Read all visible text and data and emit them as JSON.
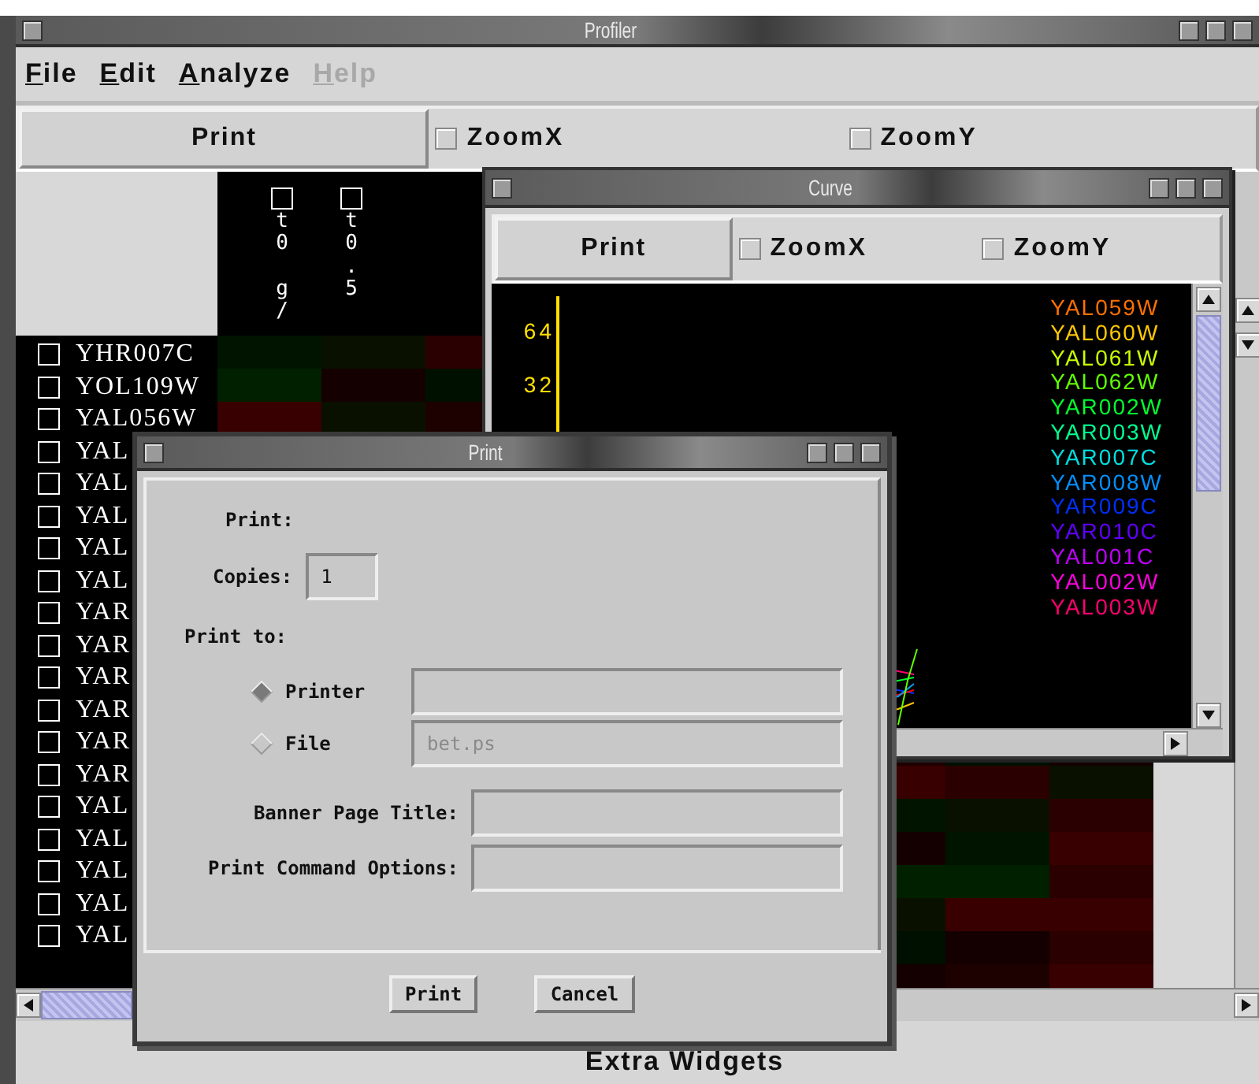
{
  "profiler": {
    "title": "Profiler",
    "menu": [
      {
        "label": "File",
        "disabled": false
      },
      {
        "label": "Edit",
        "disabled": false
      },
      {
        "label": "Analyze",
        "disabled": false
      },
      {
        "label": "Help",
        "disabled": true
      }
    ],
    "toolbar": {
      "print_button": "Print",
      "checkboxes": [
        {
          "label": "ZoomX",
          "checked": false
        },
        {
          "label": "ZoomY",
          "checked": false
        }
      ]
    },
    "columns": [
      {
        "label": "t0 g/",
        "checked": false
      },
      {
        "label": "t0.5",
        "checked": false
      }
    ],
    "genes": [
      {
        "label": "YHR007C",
        "checked": false
      },
      {
        "label": "YOL109W",
        "checked": false
      },
      {
        "label": "YAL056W",
        "checked": false
      },
      {
        "label": "YAL",
        "checked": false
      },
      {
        "label": "YAL",
        "checked": false
      },
      {
        "label": "YAL",
        "checked": false
      },
      {
        "label": "YAL",
        "checked": false
      },
      {
        "label": "YAL",
        "checked": false
      },
      {
        "label": "YAR",
        "checked": false
      },
      {
        "label": "YAR",
        "checked": false
      },
      {
        "label": "YAR",
        "checked": false
      },
      {
        "label": "YAR",
        "checked": false
      },
      {
        "label": "YAR",
        "checked": false
      },
      {
        "label": "YAR",
        "checked": false
      },
      {
        "label": "YAL",
        "checked": false
      },
      {
        "label": "YAL",
        "checked": false
      },
      {
        "label": "YAL",
        "checked": false
      },
      {
        "label": "YAL",
        "checked": false
      },
      {
        "label": "YAL",
        "checked": false
      }
    ],
    "status": "Extra Widgets"
  },
  "curve": {
    "title": "Curve",
    "toolbar": {
      "print_button": "Print",
      "checkboxes": [
        {
          "label": "ZoomX",
          "checked": false
        },
        {
          "label": "ZoomY",
          "checked": false
        }
      ]
    },
    "y_ticks": [
      "64",
      "32"
    ],
    "legend": [
      {
        "label": "YAL059W",
        "color": "#ff7000"
      },
      {
        "label": "YAL060W",
        "color": "#ffc800"
      },
      {
        "label": "YAL061W",
        "color": "#c8ff00"
      },
      {
        "label": "YAL062W",
        "color": "#60ff00"
      },
      {
        "label": "YAR002W",
        "color": "#00ff30"
      },
      {
        "label": "YAR003W",
        "color": "#00ff90"
      },
      {
        "label": "YAR007C",
        "color": "#00e0e0"
      },
      {
        "label": "YAR008W",
        "color": "#0090ff"
      },
      {
        "label": "YAR009C",
        "color": "#0030ff"
      },
      {
        "label": "YAR010C",
        "color": "#6000ff"
      },
      {
        "label": "YAL001C",
        "color": "#c000ff"
      },
      {
        "label": "YAL002W",
        "color": "#ff00e0"
      },
      {
        "label": "YAL003W",
        "color": "#ff0070"
      }
    ]
  },
  "print_dialog": {
    "title": "Print",
    "heading": "Print:",
    "copies": {
      "label": "Copies:",
      "value": "1"
    },
    "print_to": "Print to:",
    "destinations": [
      {
        "label": "Printer",
        "selected": true,
        "disabled": false
      },
      {
        "label": "File",
        "selected": false,
        "value": "bet.ps",
        "disabled": true
      }
    ],
    "fields": [
      {
        "label": "Banner Page Title:"
      },
      {
        "label": "Print Command Options:"
      }
    ],
    "buttons": [
      "Print",
      "Cancel"
    ]
  }
}
